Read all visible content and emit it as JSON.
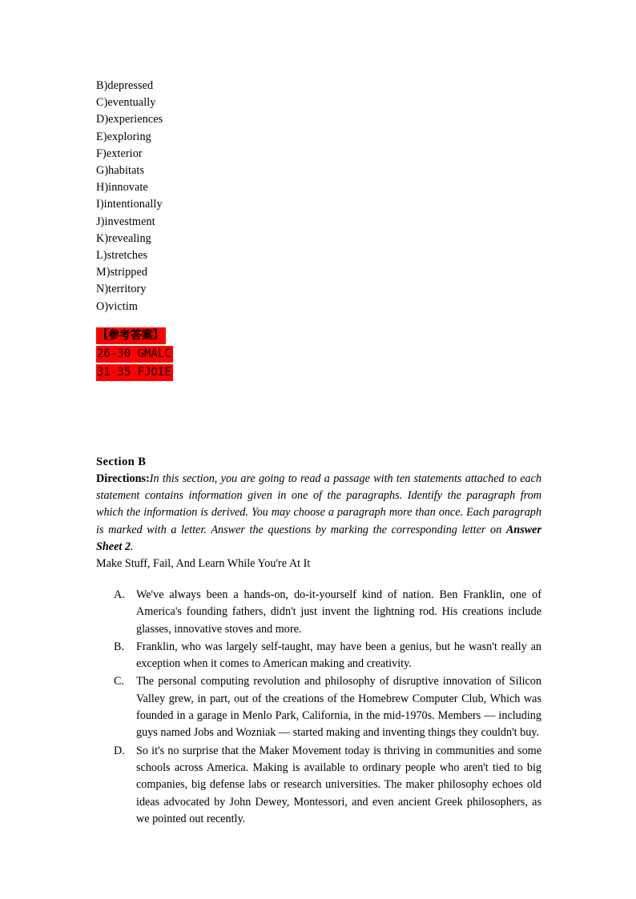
{
  "document": {
    "word_bank": {
      "items": [
        "B)depressed",
        "C)eventually",
        "D)experiences",
        "E)exploring",
        "F)exterior",
        "G)habitats",
        "H)innovate",
        "I)intentionally",
        "J)investment",
        "K)revealing",
        "L)stretches",
        "M)stripped",
        "N)territory",
        "O)victim"
      ]
    },
    "answer_key": {
      "highlight_color": "#ff0000",
      "text_color": "#000000",
      "title": "【参考答案】",
      "rows": [
        "26-30 GMALC",
        "31-35 FJOIE"
      ]
    },
    "section": {
      "heading": "Section B",
      "directions_label": "Directions:",
      "directions_text_1": "In this section, you are going to read a passage with ten statements attached to each statement contains information given in one of the paragraphs. Identify the paragraph from which the information is derived. You may choose a paragraph more than once. Each paragraph is marked with a letter. Answer the questions by marking the corresponding letter on ",
      "directions_strong": "Answer Sheet 2",
      "directions_text_2": ".",
      "passage_title": "Make Stuff, Fail, And Learn While You're At It",
      "paragraphs": [
        {
          "letter": "A.",
          "text": "We've always been a hands-on, do-it-yourself kind of nation. Ben Franklin, one of America's founding fathers, didn't just invent the lightning rod. His creations include glasses, innovative stoves and more."
        },
        {
          "letter": "B.",
          "text": "Franklin, who was largely self-taught, may have been a genius, but he wasn't really an exception when it comes to American making and creativity."
        },
        {
          "letter": "C.",
          "text": "The personal computing revolution and philosophy of disruptive innovation of Silicon Valley grew, in part, out of the creations of the Homebrew Computer Club, Which was founded in a garage in Menlo Park, California, in the mid-1970s. Members — including guys named Jobs and Wozniak — started making and inventing things they couldn't buy."
        },
        {
          "letter": "D.",
          "text": "So it's no surprise that the Maker Movement today is thriving in communities and some schools across America. Making is available to ordinary people who aren't tied to big companies, big defense labs or research universities. The maker philosophy echoes old ideas advocated by John Dewey, Montessori, and even ancient Greek philosophers, as we pointed out recently."
        }
      ]
    }
  }
}
